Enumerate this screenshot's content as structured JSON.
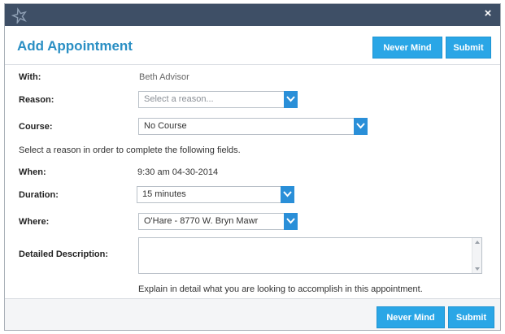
{
  "window": {
    "close_glyph": "×",
    "logo_icon": "star-logo-icon"
  },
  "dialog": {
    "title": "Add Appointment",
    "never_mind_label": "Never Mind",
    "submit_label": "Submit"
  },
  "form": {
    "with_label": "With:",
    "with_value": "Beth Advisor",
    "reason_label": "Reason:",
    "reason_value": "Select a reason...",
    "course_label": "Course:",
    "course_value": "No Course",
    "instruction": "Select a reason in order to complete the following fields.",
    "when_label": "When:",
    "when_value": "9:30 am 04-30-2014",
    "duration_label": "Duration:",
    "duration_value": "15 minutes",
    "where_label": "Where:",
    "where_value": "O'Hare  - 8770 W. Bryn Mawr",
    "description_label": "Detailed Description:",
    "description_value": "",
    "description_help": "Explain in detail what you are looking to accomplish in this appointment."
  },
  "colors": {
    "titlebar": "#3e4f66",
    "accent": "#2aa6e6",
    "title_text": "#2a8fc4"
  }
}
